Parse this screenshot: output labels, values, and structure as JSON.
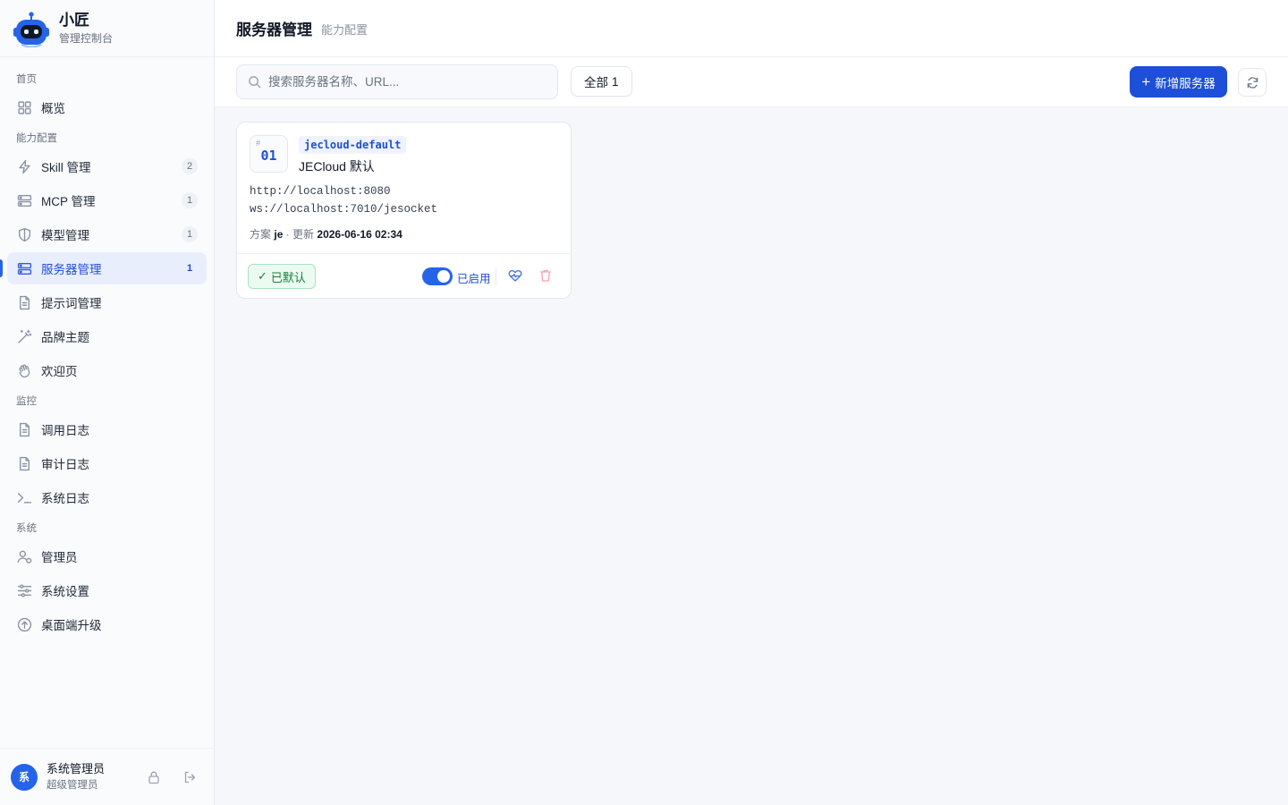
{
  "brand": {
    "name": "小匠",
    "subtitle": "管理控制台"
  },
  "sidebar": {
    "groups": [
      {
        "label": "首页",
        "items": [
          {
            "label": "概览",
            "icon": "grid-icon"
          }
        ]
      },
      {
        "label": "能力配置",
        "items": [
          {
            "label": "Skill 管理",
            "icon": "bolt-icon",
            "count": "2"
          },
          {
            "label": "MCP 管理",
            "icon": "server-icon",
            "count": "1"
          },
          {
            "label": "模型管理",
            "icon": "shield-icon",
            "count": "1"
          },
          {
            "label": "服务器管理",
            "icon": "server-icon",
            "count": "1",
            "active": true
          },
          {
            "label": "提示词管理",
            "icon": "file-icon"
          },
          {
            "label": "品牌主题",
            "icon": "magic-wand-icon"
          },
          {
            "label": "欢迎页",
            "icon": "wave-hand-icon"
          }
        ]
      },
      {
        "label": "监控",
        "items": [
          {
            "label": "调用日志",
            "icon": "file-icon"
          },
          {
            "label": "审计日志",
            "icon": "file-icon"
          },
          {
            "label": "系统日志",
            "icon": "terminal-icon"
          }
        ]
      },
      {
        "label": "系统",
        "items": [
          {
            "label": "管理员",
            "icon": "users-icon"
          },
          {
            "label": "系统设置",
            "icon": "sliders-icon"
          },
          {
            "label": "桌面端升级",
            "icon": "upload-circle-icon"
          }
        ]
      }
    ]
  },
  "user": {
    "avatar": "系",
    "name": "系统管理员",
    "role": "超级管理员"
  },
  "header": {
    "title": "服务器管理",
    "crumb": "能力配置"
  },
  "toolbar": {
    "search_placeholder": "搜索服务器名称、URL...",
    "search_value": "",
    "filter_label": "全部",
    "filter_count": "1",
    "add_label": "新增服务器"
  },
  "servers": [
    {
      "hash": "#",
      "index": "01",
      "code": "jecloud-default",
      "name": "JECloud 默认",
      "http_url": "http://localhost:8080",
      "ws_url": "ws://localhost:7010/jesocket",
      "meta_plan_label": "方案",
      "meta_plan": "je",
      "meta_sep": " · ",
      "meta_updated_label": "更新",
      "meta_updated": "2026-06-16 02:34",
      "default_label": "已默认",
      "enabled": true,
      "enabled_label": "已启用"
    }
  ],
  "colors": {
    "primary": "#1d4fd8",
    "success": "#15803d",
    "danger": "#f5a3ad"
  }
}
